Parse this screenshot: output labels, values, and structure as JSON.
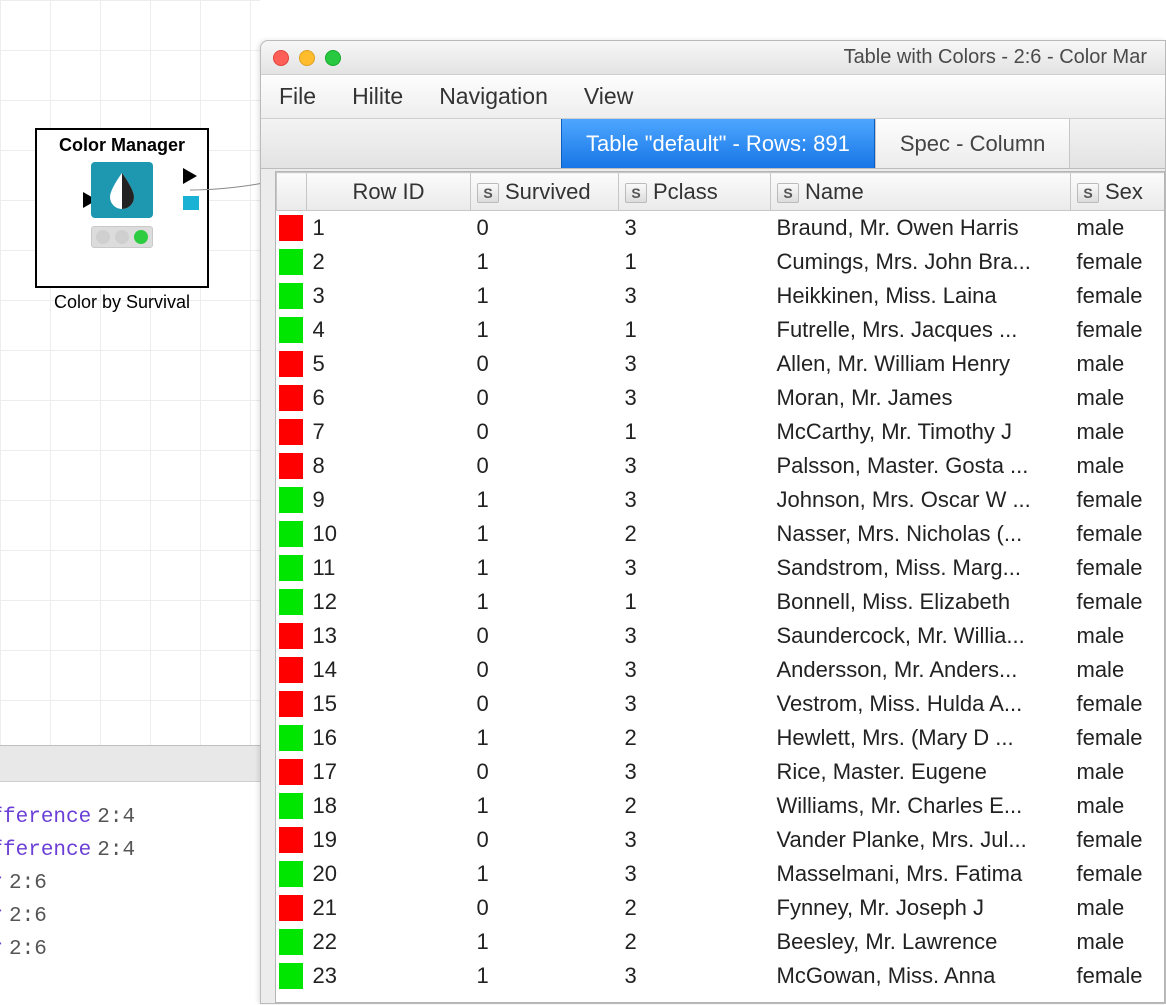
{
  "canvas": {
    "node_title": "Color Manager",
    "node_caption": "Color by Survival"
  },
  "console": {
    "lines": [
      {
        "text": "e Difference",
        "num": "2:4"
      },
      {
        "text": "e Difference",
        "num": "2:4"
      },
      {
        "text": "nager",
        "num": "2:6"
      },
      {
        "text": "nager",
        "num": "2:6"
      },
      {
        "text": "nager",
        "num": "2:6"
      }
    ]
  },
  "window": {
    "title": "Table with Colors - 2:6 - Color Mar",
    "menus": [
      "File",
      "Hilite",
      "Navigation",
      "View"
    ],
    "tabs": {
      "active": "Table \"default\" - Rows: 891",
      "other": "Spec - Column"
    }
  },
  "table": {
    "columns": {
      "rowid": "Row ID",
      "survived": "Survived",
      "pclass": "Pclass",
      "name": "Name",
      "sex": "Sex"
    },
    "rows": [
      {
        "id": "1",
        "surv": "0",
        "pclass": "3",
        "name": "Braund, Mr. Owen Harris",
        "sex": "male",
        "c": "red"
      },
      {
        "id": "2",
        "surv": "1",
        "pclass": "1",
        "name": "Cumings, Mrs. John Bra...",
        "sex": "female",
        "c": "green"
      },
      {
        "id": "3",
        "surv": "1",
        "pclass": "3",
        "name": "Heikkinen, Miss. Laina",
        "sex": "female",
        "c": "green"
      },
      {
        "id": "4",
        "surv": "1",
        "pclass": "1",
        "name": "Futrelle, Mrs. Jacques ...",
        "sex": "female",
        "c": "green"
      },
      {
        "id": "5",
        "surv": "0",
        "pclass": "3",
        "name": "Allen, Mr. William Henry",
        "sex": "male",
        "c": "red"
      },
      {
        "id": "6",
        "surv": "0",
        "pclass": "3",
        "name": "Moran, Mr. James",
        "sex": "male",
        "c": "red"
      },
      {
        "id": "7",
        "surv": "0",
        "pclass": "1",
        "name": "McCarthy, Mr. Timothy J",
        "sex": "male",
        "c": "red"
      },
      {
        "id": "8",
        "surv": "0",
        "pclass": "3",
        "name": "Palsson, Master. Gosta ...",
        "sex": "male",
        "c": "red"
      },
      {
        "id": "9",
        "surv": "1",
        "pclass": "3",
        "name": "Johnson, Mrs. Oscar W ...",
        "sex": "female",
        "c": "green"
      },
      {
        "id": "10",
        "surv": "1",
        "pclass": "2",
        "name": "Nasser, Mrs. Nicholas (...",
        "sex": "female",
        "c": "green"
      },
      {
        "id": "11",
        "surv": "1",
        "pclass": "3",
        "name": "Sandstrom, Miss. Marg...",
        "sex": "female",
        "c": "green"
      },
      {
        "id": "12",
        "surv": "1",
        "pclass": "1",
        "name": "Bonnell, Miss. Elizabeth",
        "sex": "female",
        "c": "green"
      },
      {
        "id": "13",
        "surv": "0",
        "pclass": "3",
        "name": "Saundercock, Mr. Willia...",
        "sex": "male",
        "c": "red"
      },
      {
        "id": "14",
        "surv": "0",
        "pclass": "3",
        "name": "Andersson, Mr. Anders...",
        "sex": "male",
        "c": "red"
      },
      {
        "id": "15",
        "surv": "0",
        "pclass": "3",
        "name": "Vestrom, Miss. Hulda A...",
        "sex": "female",
        "c": "red"
      },
      {
        "id": "16",
        "surv": "1",
        "pclass": "2",
        "name": "Hewlett, Mrs. (Mary D ...",
        "sex": "female",
        "c": "green"
      },
      {
        "id": "17",
        "surv": "0",
        "pclass": "3",
        "name": "Rice, Master. Eugene",
        "sex": "male",
        "c": "red"
      },
      {
        "id": "18",
        "surv": "1",
        "pclass": "2",
        "name": "Williams, Mr. Charles E...",
        "sex": "male",
        "c": "green"
      },
      {
        "id": "19",
        "surv": "0",
        "pclass": "3",
        "name": "Vander Planke, Mrs. Jul...",
        "sex": "female",
        "c": "red"
      },
      {
        "id": "20",
        "surv": "1",
        "pclass": "3",
        "name": "Masselmani, Mrs. Fatima",
        "sex": "female",
        "c": "green"
      },
      {
        "id": "21",
        "surv": "0",
        "pclass": "2",
        "name": "Fynney, Mr. Joseph J",
        "sex": "male",
        "c": "red"
      },
      {
        "id": "22",
        "surv": "1",
        "pclass": "2",
        "name": "Beesley, Mr. Lawrence",
        "sex": "male",
        "c": "green"
      },
      {
        "id": "23",
        "surv": "1",
        "pclass": "3",
        "name": "McGowan, Miss. Anna",
        "sex": "female",
        "c": "green"
      }
    ]
  }
}
